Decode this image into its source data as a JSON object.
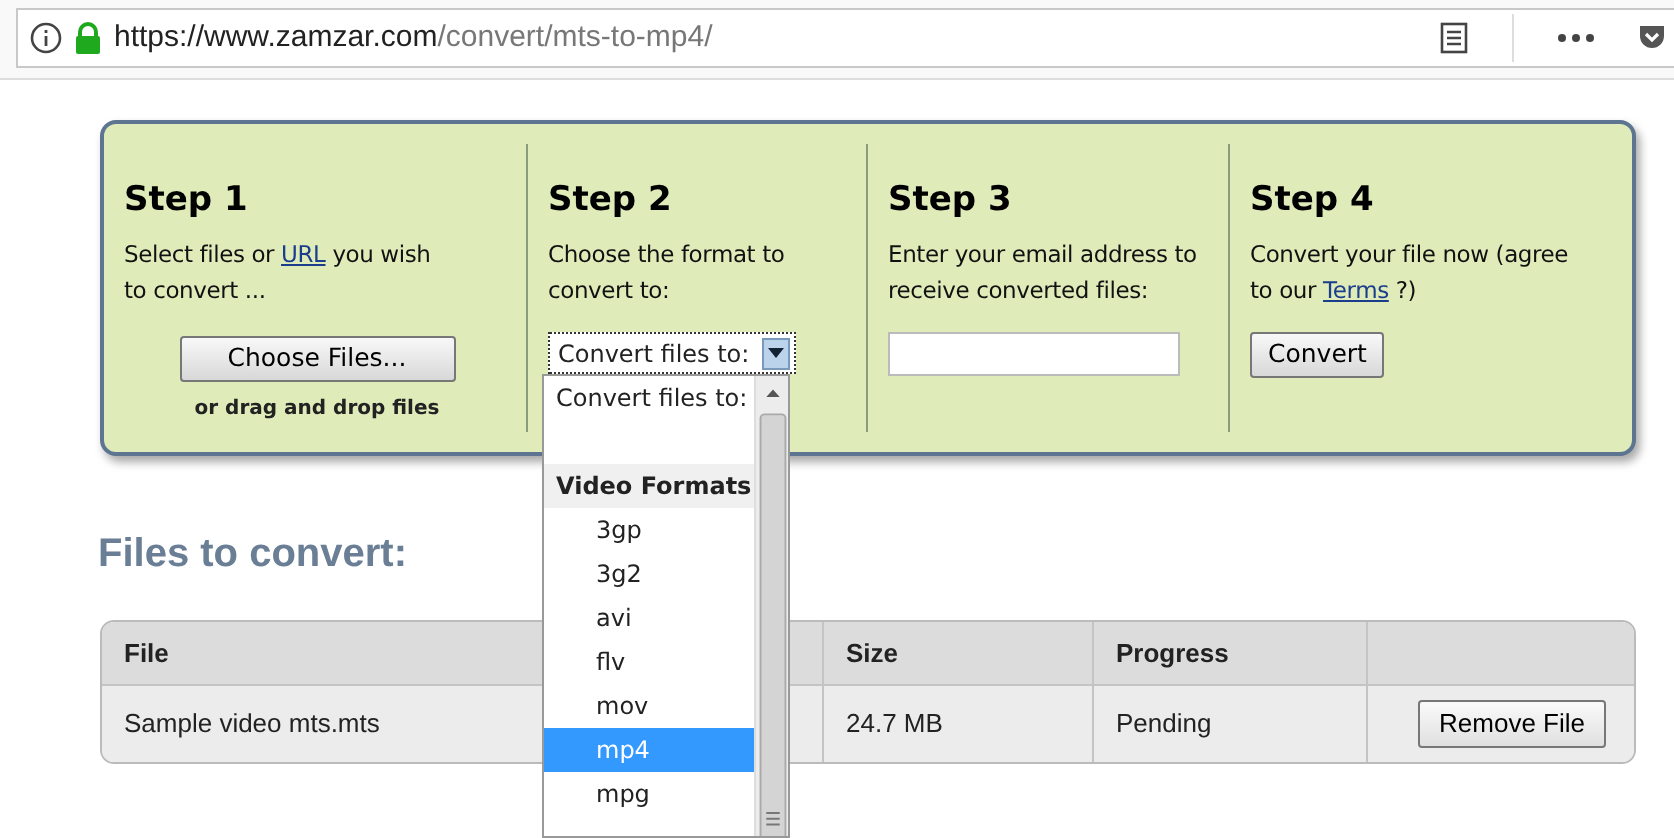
{
  "address_bar": {
    "url_host": "https://www.zamzar.com",
    "url_path": "/convert/mts-to-mp4/"
  },
  "steps": [
    {
      "kind": "upload",
      "title": "Step 1",
      "text_before": "Select files or ",
      "link": "URL",
      "text_after": " you wish to convert ...",
      "button": "Choose Files...",
      "note": "or drag and drop files"
    },
    {
      "kind": "format",
      "title": "Step 2",
      "text": "Choose the format to convert to:",
      "select_value": "Convert files to:",
      "expanded": true
    },
    {
      "kind": "email",
      "title": "Step 3",
      "text": "Enter your email address to receive converted files:"
    },
    {
      "kind": "convert",
      "title": "Step 4",
      "text_before": "Convert your file now (agree to our ",
      "link": "Terms",
      "text_after": " ?)",
      "button": "Convert"
    }
  ],
  "dropdown": {
    "options": [
      {
        "kind": "option",
        "label": "Convert files to:",
        "selected": false
      },
      {
        "kind": "spacer"
      },
      {
        "kind": "group",
        "label": "Video Formats"
      },
      {
        "kind": "option",
        "label": "3gp",
        "selected": false
      },
      {
        "kind": "option",
        "label": "3g2",
        "selected": false
      },
      {
        "kind": "option",
        "label": "avi",
        "selected": false
      },
      {
        "kind": "option",
        "label": "flv",
        "selected": false
      },
      {
        "kind": "option",
        "label": "mov",
        "selected": false
      },
      {
        "kind": "option",
        "label": "mp4",
        "selected": true
      },
      {
        "kind": "option",
        "label": "mpg",
        "selected": false
      }
    ]
  },
  "files_heading": "Files to convert:",
  "table": {
    "columns": [
      "File",
      "Size",
      "Progress"
    ],
    "rows": [
      {
        "file": "Sample video mts.mts",
        "size": "24.7 MB",
        "progress": "Pending",
        "action": "Remove File"
      }
    ]
  }
}
